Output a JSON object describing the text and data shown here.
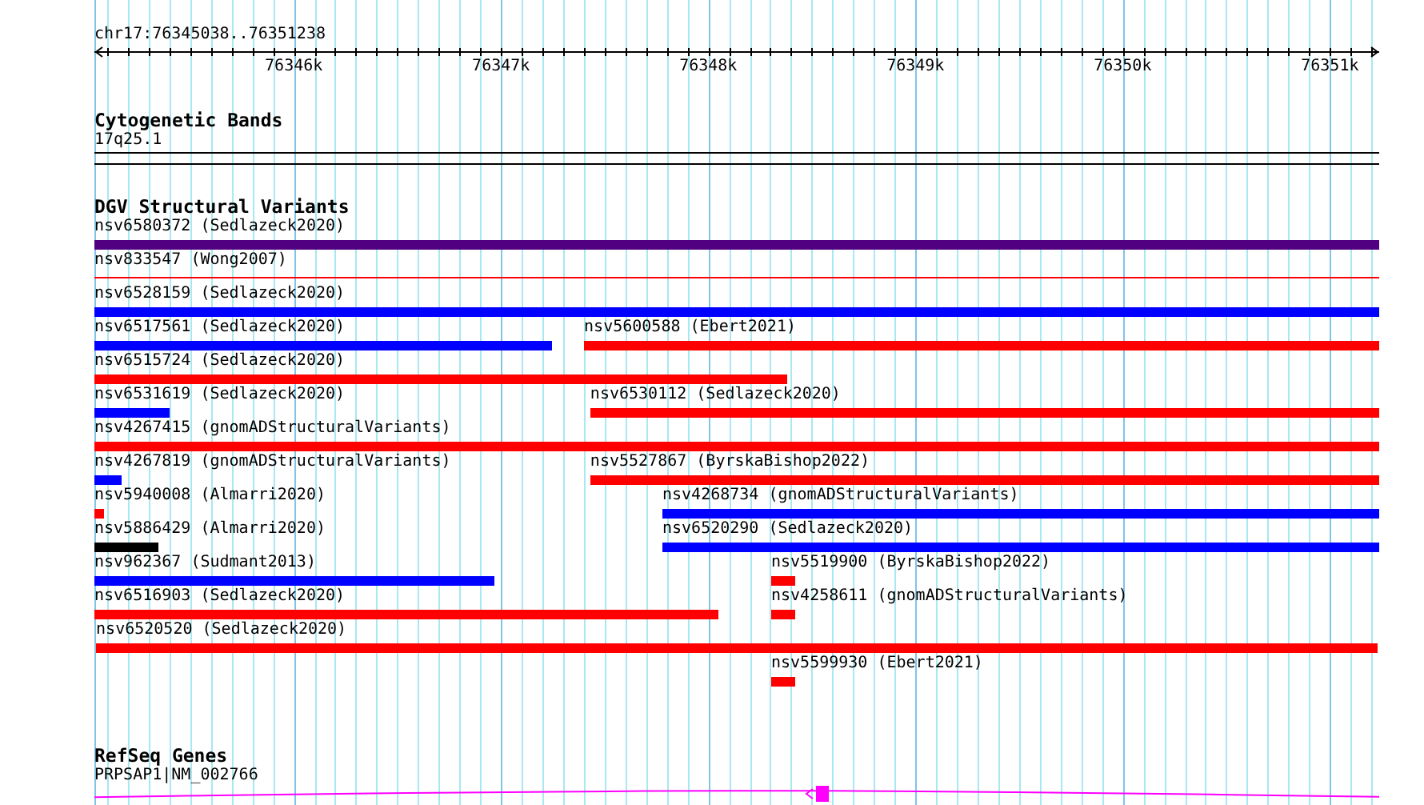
{
  "ruler": {
    "location": "chr17:76345038..76351238",
    "tick_labels": [
      "76346k",
      "76347k",
      "76348k",
      "76349k",
      "76350k",
      "76351k"
    ]
  },
  "tracks": [
    {
      "kind": "cytoband",
      "title": "Cytogenetic Bands",
      "bands": [
        "17q25.1"
      ]
    },
    {
      "kind": "variants",
      "title": "DGV Structural Variants",
      "lanes": [
        {
          "features": [
            {
              "label": "nsv6580372 (Sedlazeck2020)",
              "kind": "bar",
              "color": "#500080"
            }
          ]
        },
        {
          "features": [
            {
              "label": "nsv833547 (Wong2007)",
              "kind": "line",
              "color": "#ff0000"
            }
          ]
        },
        {
          "features": [
            {
              "label": "nsv6528159 (Sedlazeck2020)",
              "kind": "bar",
              "color": "#0000ff"
            }
          ]
        },
        {
          "features": [
            {
              "label": "nsv6517561 (Sedlazeck2020)",
              "kind": "bar",
              "color": "#0000ff"
            },
            {
              "label": "nsv5600588 (Ebert2021)",
              "kind": "bar",
              "color": "#ff0000"
            }
          ]
        },
        {
          "features": [
            {
              "label": "nsv6515724 (Sedlazeck2020)",
              "kind": "bar",
              "color": "#ff0000"
            }
          ]
        },
        {
          "features": [
            {
              "label": "nsv6531619 (Sedlazeck2020)",
              "kind": "bar",
              "color": "#0000ff"
            },
            {
              "label": "nsv6530112 (Sedlazeck2020)",
              "kind": "bar",
              "color": "#ff0000"
            }
          ]
        },
        {
          "features": [
            {
              "label": "nsv4267415 (gnomADStructuralVariants)",
              "kind": "bar",
              "color": "#ff0000"
            }
          ]
        },
        {
          "features": [
            {
              "label": "nsv4267819 (gnomADStructuralVariants)",
              "kind": "bar",
              "color": "#0000ff"
            },
            {
              "label": "nsv5527867 (ByrskaBishop2022)",
              "kind": "bar",
              "color": "#ff0000"
            }
          ]
        },
        {
          "features": [
            {
              "label": "nsv5940008 (Almarri2020)",
              "kind": "bar",
              "color": "#ff0000"
            },
            {
              "label": "nsv4268734 (gnomADStructuralVariants)",
              "kind": "bar",
              "color": "#0000ff"
            }
          ]
        },
        {
          "features": [
            {
              "label": "nsv5886429 (Almarri2020)",
              "kind": "bar",
              "color": "#000000"
            },
            {
              "label": "nsv6520290 (Sedlazeck2020)",
              "kind": "bar",
              "color": "#0000ff"
            }
          ]
        },
        {
          "features": [
            {
              "label": "nsv962367 (Sudmant2013)",
              "kind": "bar",
              "color": "#0000ff"
            },
            {
              "label": "nsv5519900 (ByrskaBishop2022)",
              "kind": "bar",
              "color": "#ff0000"
            }
          ]
        },
        {
          "features": [
            {
              "label": "nsv6516903 (Sedlazeck2020)",
              "kind": "bar",
              "color": "#ff0000"
            },
            {
              "label": "nsv4258611 (gnomADStructuralVariants)",
              "kind": "bar",
              "color": "#ff0000"
            }
          ]
        },
        {
          "features": [
            {
              "label": "nsv6520520 (Sedlazeck2020)",
              "kind": "bar",
              "color": "#ff0000"
            }
          ]
        },
        {
          "features": [
            {
              "label": "nsv5599930 (Ebert2021)",
              "kind": "bar",
              "color": "#ff0000"
            }
          ]
        }
      ]
    },
    {
      "kind": "genes",
      "title": "RefSeq Genes",
      "genes": [
        {
          "label": "PRPSAP1|NM_002766",
          "reverse_strand": true
        }
      ]
    }
  ]
}
